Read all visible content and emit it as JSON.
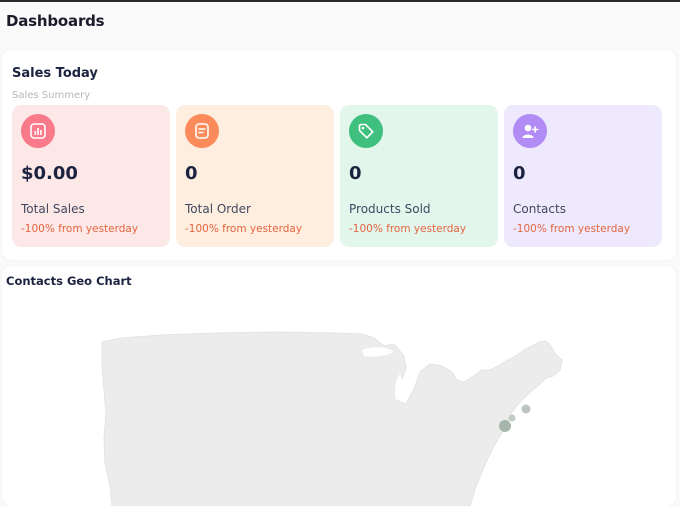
{
  "page": {
    "title": "Dashboards"
  },
  "sales": {
    "title": "Sales Today",
    "subtitle": "Sales Summery",
    "cards": [
      {
        "icon": "bar-chart-icon",
        "value": "$0.00",
        "label": "Total Sales",
        "change": "-100% from yesterday",
        "bg": "#fde8e8",
        "icon_bg": "#f87a8b"
      },
      {
        "icon": "document-icon",
        "value": "0",
        "label": "Total Order",
        "change": "-100% from yesterday",
        "bg": "#fdeee0",
        "icon_bg": "#fb8b5a"
      },
      {
        "icon": "tag-icon",
        "value": "0",
        "label": "Products Sold",
        "change": "-100% from yesterday",
        "bg": "#e2f6ec",
        "icon_bg": "#3fc07f"
      },
      {
        "icon": "add-user-icon",
        "value": "0",
        "label": "Contacts",
        "change": "-100% from yesterday",
        "bg": "#eee9fd",
        "icon_bg": "#b08cf4"
      }
    ]
  },
  "geo": {
    "title": "Contacts Geo Chart",
    "map_color": "#ececec",
    "marker_color": "#a8b5ad"
  }
}
